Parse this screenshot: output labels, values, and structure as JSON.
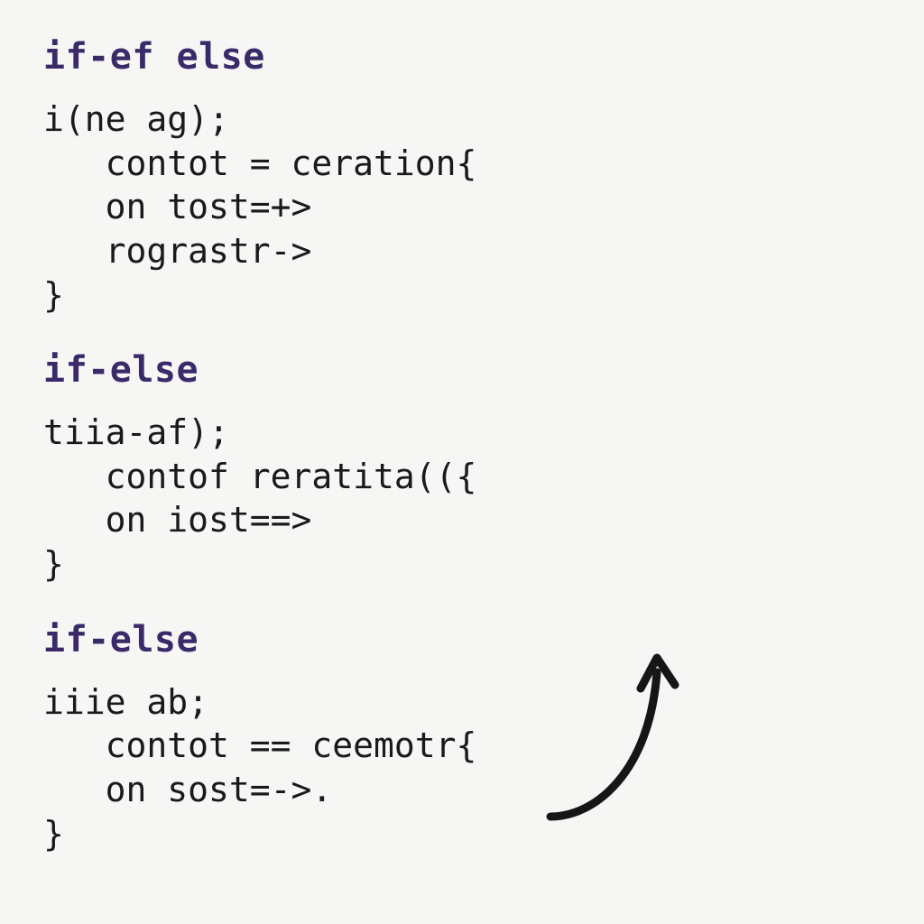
{
  "blocks": [
    {
      "heading": "if-ef else",
      "code": "i(ne ag);\n   contot = ceration{\n   on tost=+>\n   rograstr->\n}"
    },
    {
      "heading": "if-else",
      "code": "tiia-af);\n   contof reratita(({\n   on iost==>\n}"
    },
    {
      "heading": "if-else",
      "code": "iiie ab;\n   contot == ceemotr{\n   on sost=->.\n}"
    }
  ]
}
